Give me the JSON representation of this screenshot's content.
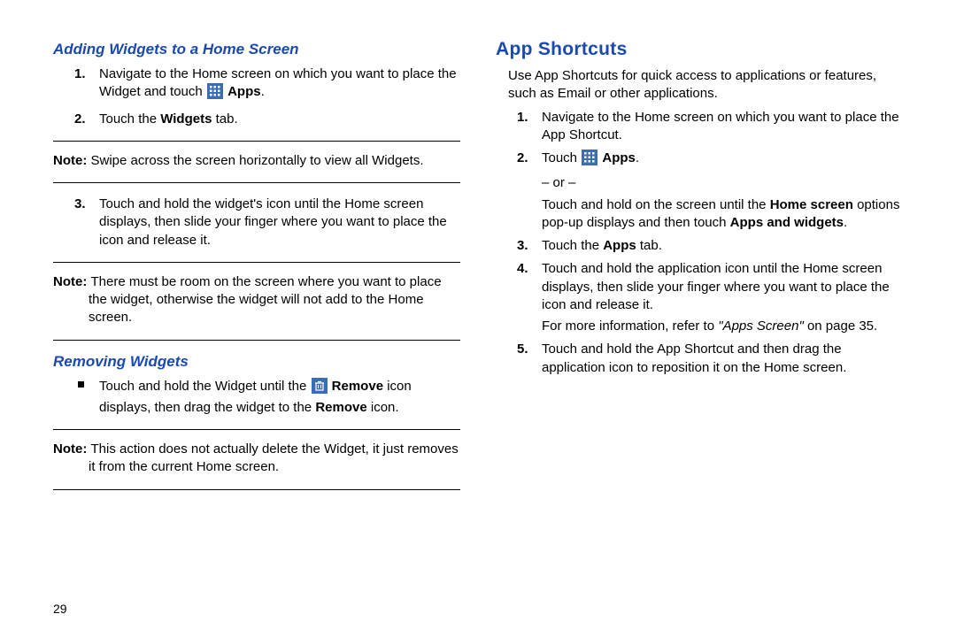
{
  "pageNumber": "29",
  "left": {
    "h1": "Adding Widgets to a Home Screen",
    "step1a": "Navigate to the Home screen on which you want to place the Widget and touch ",
    "step1b": "Apps",
    "step1c": ".",
    "step2a": "Touch the ",
    "step2b": "Widgets",
    "step2c": " tab.",
    "note1label": "Note: ",
    "note1text": "Swipe across the screen horizontally to view all Widgets.",
    "step3": "Touch and hold the widget's icon until the Home screen displays, then slide your finger where you want to place the icon and release it.",
    "note2label": "Note: ",
    "note2text": "There must be room on the screen where you want to place the widget, otherwise the widget will not add to the Home screen.",
    "h2": "Removing Widgets",
    "bullet_a": "Touch and hold the Widget until the ",
    "bullet_remove1": "Remove",
    "bullet_b": " icon displays, then drag the widget to the ",
    "bullet_remove2": "Remove",
    "bullet_c": " icon.",
    "note3label": "Note: ",
    "note3text": "This action does not actually delete the Widget, it just removes it from the current Home screen."
  },
  "right": {
    "h1": "App Shortcuts",
    "intro": "Use App Shortcuts for quick access to applications or features, such as Email or other applications.",
    "step1": "Navigate to the Home screen on which you want to place the App Shortcut.",
    "step2a": "Touch ",
    "step2b": "Apps",
    "step2c": ".",
    "or": "– or –",
    "step2d": "Touch and hold on the screen until the ",
    "step2e": "Home screen",
    "step2f": " options pop-up displays and then touch ",
    "step2g": "Apps and widgets",
    "step2h": ".",
    "step3a": "Touch the ",
    "step3b": "Apps",
    "step3c": " tab.",
    "step4": "Touch and hold the application icon until the Home screen displays, then slide your finger where you want to place the icon and release it.",
    "refA": "For more information, refer to ",
    "refB": "\"Apps Screen\"",
    "refC": " on page 35.",
    "step5": "Touch and hold the App Shortcut and then drag the application icon to reposition it on the Home screen."
  }
}
